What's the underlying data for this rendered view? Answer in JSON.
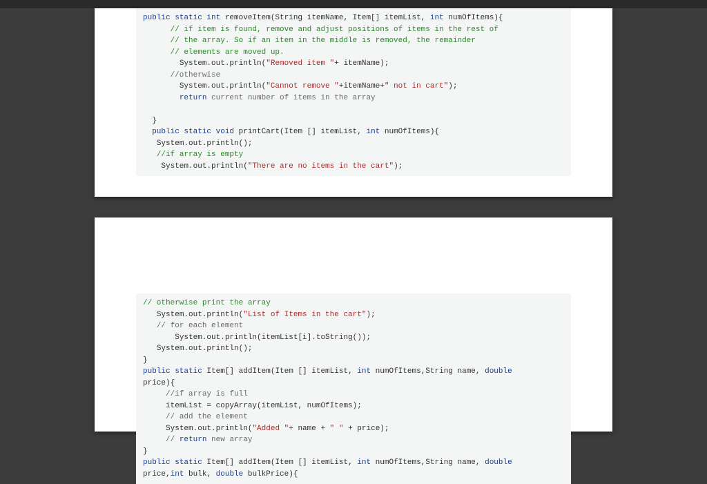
{
  "block1": {
    "sig_kw": "public static int",
    "sig_rest": " removeItem(String itemName, Item[] itemList, ",
    "sig_kw2": "int",
    "sig_rest2": " numOfItems){",
    "c1": "// if item is found, remove and adjust positions of items in the rest of",
    "c2": "// the array. So if an item in the middle is removed, the remainder",
    "c3": "// elements are moved up.",
    "p1a": "System.out.println(",
    "p1s": "\"Removed item \"",
    "p1b": "+ itemName);",
    "c4": "//otherwise",
    "p2a": "System.out.println(",
    "p2s1": "\"Cannot remove \"",
    "p2mid": "+itemName+",
    "p2s2": "\" not in cart\"",
    "p2end": ");",
    "ret_kw": "return",
    "ret_rest": " current number of items in the array",
    "close": "}",
    "sig2_kw": "public static void",
    "sig2_rest": " printCart(Item [] itemList, ",
    "sig2_kw2": "int",
    "sig2_rest2": " numOfItems){",
    "p3": "System.out.println();",
    "c5": "//if array is empty",
    "p4a": "System.out.println(",
    "p4s": "\"There are no items in the cart\"",
    "p4b": ");"
  },
  "block2": {
    "c1": "// otherwise print the array",
    "p1a": "System.out.println(",
    "p1s": "\"List of Items in the cart\"",
    "p1b": ");",
    "c2": "// for each element",
    "p2": "System.out.println(itemList[i].toString());",
    "p3": "System.out.println();",
    "close1": "}",
    "sig1_kw": "public static",
    "sig1_rest1": " Item[] addItem(Item [] itemList, ",
    "sig1_kw2": "int",
    "sig1_rest2": " numOfItems,String name, ",
    "sig1_kw3": "double",
    "sig1_line2": "price){",
    "c3": "//if array is full",
    "p4": "itemList = copyArray(itemList, numOfItems);",
    "c4": "// add the element",
    "p5a": "System.out.println(",
    "p5s1": "\"Added \"",
    "p5mid": "+ name + ",
    "p5s2": "\" \"",
    "p5end": " + price);",
    "c5a": "// ",
    "c5kw": "return",
    "c5b": " new array",
    "close2": "}",
    "sig2_kw": "public static",
    "sig2_rest1": " Item[] addItem(Item [] itemList, ",
    "sig2_kw2": "int",
    "sig2_rest2": " numOfItems,String name, ",
    "sig2_kw3": "double",
    "sig2_line2a": "price,",
    "sig2_line2kw": "int",
    "sig2_line2b": " bulk, ",
    "sig2_line2kw2": "double",
    "sig2_line2c": " bulkPrice){"
  }
}
